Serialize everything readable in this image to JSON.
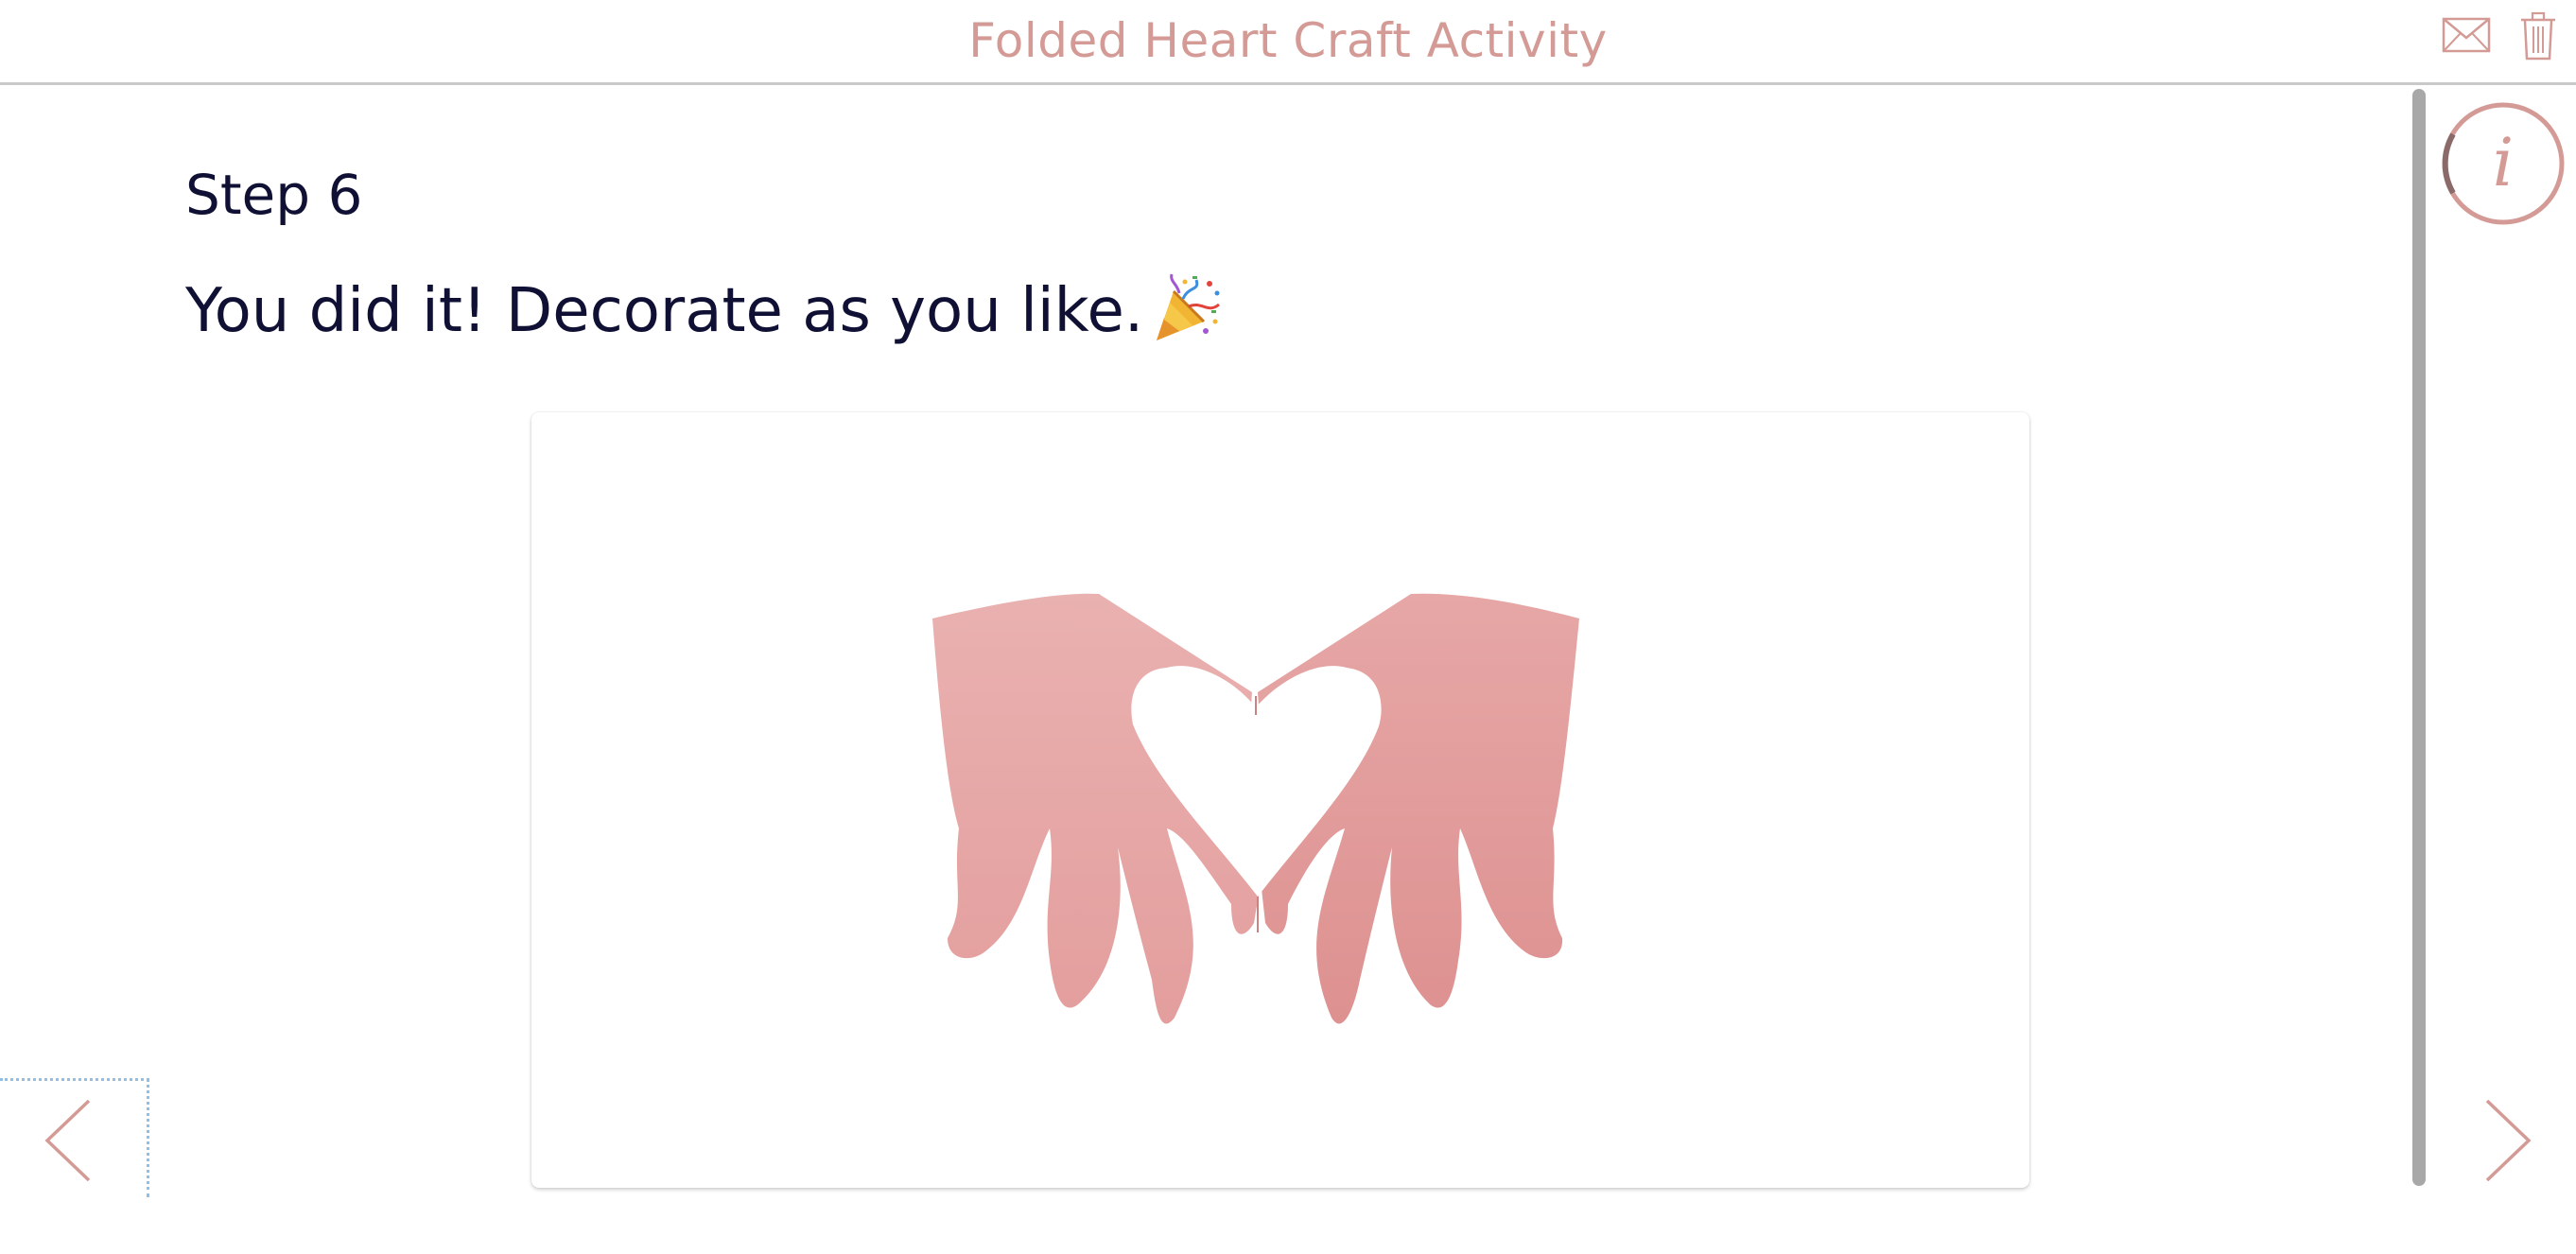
{
  "header": {
    "title": "Folded Heart Craft Activity",
    "mail_icon": "mail-icon",
    "trash_icon": "trash-icon"
  },
  "content": {
    "step_label": "Step 6",
    "instruction": "You did it! Decorate as you like.",
    "emoji_icon": "party-popper-icon",
    "image_description_icon": "paper-hands-heart-image"
  },
  "info": {
    "icon": "info-icon",
    "progress_fraction": 0.17
  },
  "nav": {
    "prev_icon": "chevron-left-icon",
    "next_icon": "chevron-right-icon"
  },
  "colors": {
    "accent": "#d49b96",
    "text": "#0f1034",
    "paper": "#e8aaa8",
    "divider": "#c9c9c9",
    "focus": "#8fc0ea"
  }
}
